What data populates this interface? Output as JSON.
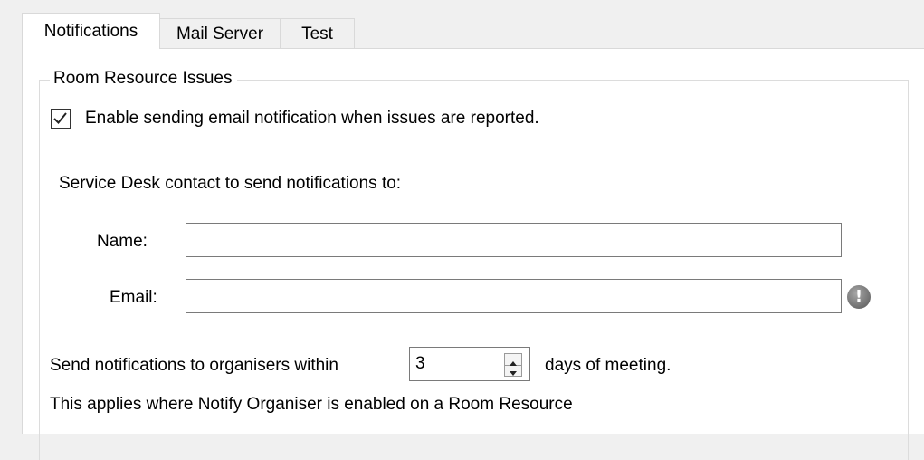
{
  "tabs": [
    {
      "label": "Notifications",
      "active": true
    },
    {
      "label": "Mail Server",
      "active": false
    },
    {
      "label": "Test",
      "active": false
    }
  ],
  "group": {
    "legend": "Room Resource Issues",
    "enable_checkbox": {
      "checked": true,
      "label": "Enable sending email notification when issues are reported."
    },
    "contact_heading": "Service Desk contact to send notifications to:",
    "name_field": {
      "label": "Name:",
      "value": ""
    },
    "email_field": {
      "label": "Email:",
      "value": "",
      "status_icon": "warning-exclamation-icon"
    },
    "organiser": {
      "prefix": "Send notifications to organisers within",
      "days_value": "3",
      "suffix": "days of meeting.",
      "note": "This applies where Notify Organiser is enabled on a Room Resource"
    }
  },
  "icons": {
    "checkmark": "✓",
    "warning": "!",
    "spin_up": "▲",
    "spin_down": "▼"
  }
}
